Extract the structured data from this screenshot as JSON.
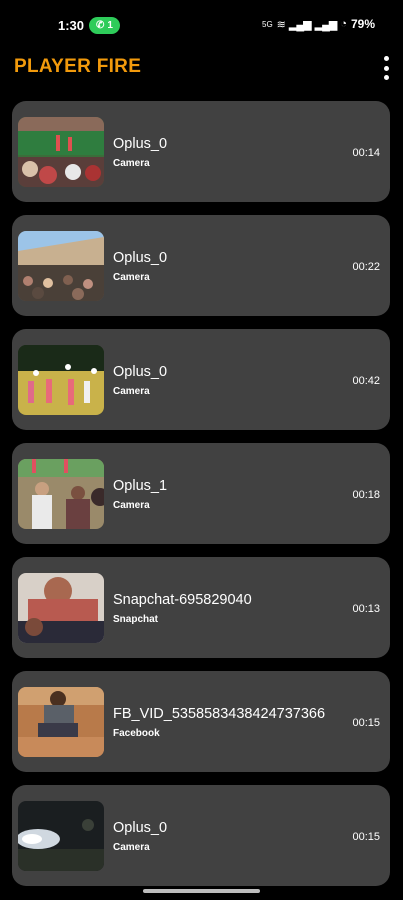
{
  "status_bar": {
    "time": "1:30",
    "call_count": "1",
    "network": "5G",
    "battery": "79%"
  },
  "app_bar": {
    "title": "PLAYER FIRE",
    "menu_icon": "more-vertical-icon"
  },
  "videos": [
    {
      "title": "Oplus_0",
      "source": "Camera",
      "duration": "00:14"
    },
    {
      "title": "Oplus_0",
      "source": "Camera",
      "duration": "00:22"
    },
    {
      "title": "Oplus_0",
      "source": "Camera",
      "duration": "00:42"
    },
    {
      "title": "Oplus_1",
      "source": "Camera",
      "duration": "00:18"
    },
    {
      "title": "Snapchat-695829040",
      "source": "Snapchat",
      "duration": "00:13"
    },
    {
      "title": "FB_VID_5358583438424737366",
      "source": "Facebook",
      "duration": "00:15"
    },
    {
      "title": "Oplus_0",
      "source": "Camera",
      "duration": "00:15"
    }
  ],
  "colors": {
    "accent": "#f29a0c",
    "card": "#414141",
    "background": "#000000"
  }
}
